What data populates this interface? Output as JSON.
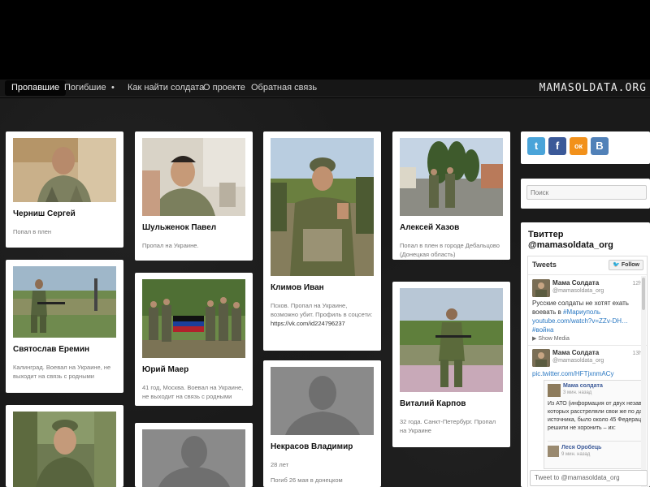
{
  "nav": {
    "items": [
      "Пропавшие",
      "Погибшие",
      "•",
      "Как найти солдата",
      "О проекте",
      "Обратная связь"
    ],
    "brand": "MAMASOLDATA.ORG"
  },
  "cards": [
    {
      "name": "Черниш Сергей",
      "desc": "Попал в плен"
    },
    {
      "name": "Святослав Еремин",
      "desc": "Калинград. Воевал на Украине, не выходит на связь с родными"
    },
    {
      "name": "Шульженок Павел",
      "desc": "Пропал на Украине."
    },
    {
      "name": "Юрий Маер",
      "desc": "41 год, Москва. Воевал на Украине, не выходит на связь с родными"
    },
    {
      "name": "Климов Иван",
      "desc": "Псков. Пропал на Украине, возможно убит. Профиль в соцсети:",
      "link": "https://vk.com/id224796237"
    },
    {
      "name": "Некрасов Владимир",
      "desc": "28 лет",
      "desc2": "Погиб 26 мая в донецком"
    },
    {
      "name": "Алексей Хазов",
      "desc": "Попал в плен в городе Дебальцово (Донецкая область)"
    },
    {
      "name": "Виталий Карпов",
      "desc": "32 года. Санкт-Петербург. Пропал на Украине"
    }
  ],
  "sidebar": {
    "share": [
      "t",
      "f",
      "ок",
      "В"
    ],
    "share_colors": [
      "#4aa4d9",
      "#3b5998",
      "#f2911b",
      "#5181b8"
    ],
    "search_placeholder": "Поиск",
    "twitter_heading": "Твиттер\n@mamasoldata_org",
    "widget": {
      "title": "Tweets",
      "follow": "Follow",
      "tweets": [
        {
          "author": "Мама Солдата",
          "handle": "@mamasoldata_org",
          "time": "12h",
          "text_lines": [
            "Русские солдаты не хотят ехать",
            "воевать в #Мариуполь",
            "youtube.com/watch?v=ZZv-DH…",
            "#война"
          ],
          "media": "Show Media"
        },
        {
          "author": "Мама Солдата",
          "handle": "@mamasoldata_org",
          "time": "13h",
          "text_lines": [
            "pic.twitter.com/HFTjxnmACy"
          ]
        }
      ],
      "embed": {
        "author": "Мама солдата",
        "meta": "3 мин. назад",
        "text": "Из АТО (информация от двух независ солдат, которых расстреляли свои же по данным источника, было около 45 Федерации решили не хоронить – их:",
        "reply_author": "Леся Оробець",
        "reply_meta": "9 мин. назад"
      },
      "reply_placeholder": "Tweet to @mamasoldata_org"
    }
  }
}
